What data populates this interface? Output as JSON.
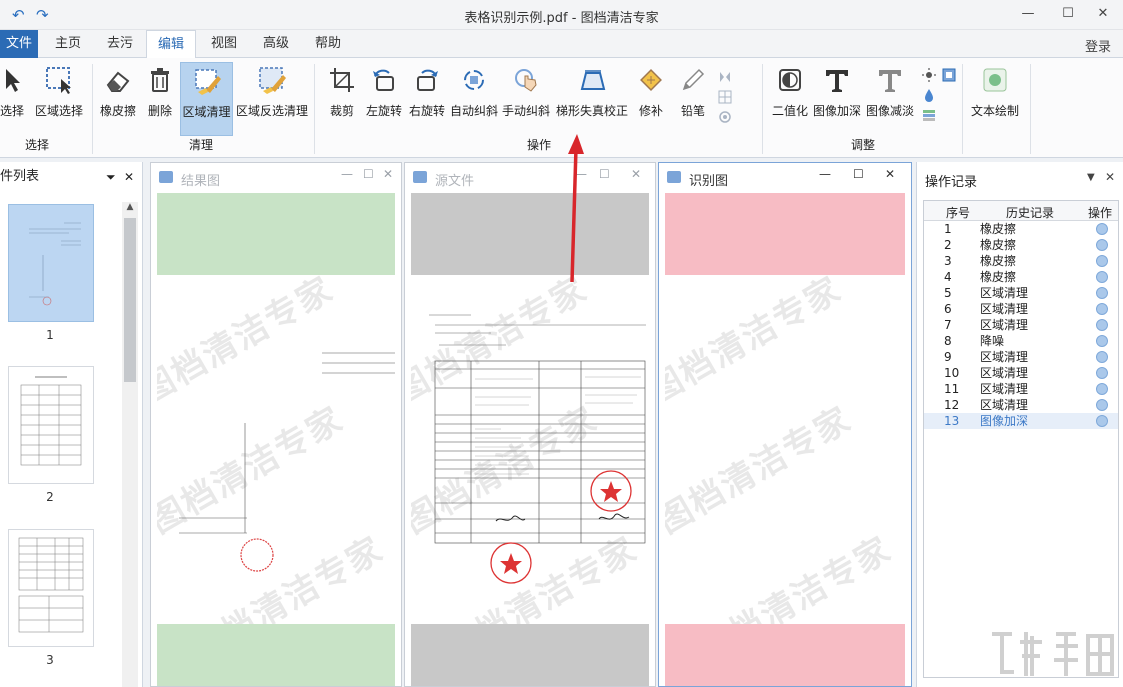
{
  "window": {
    "title": "表格识别示例.pdf - 图档清洁专家",
    "undo_icon": "undo-arrow-icon",
    "redo_icon": "redo-arrow-icon",
    "minimize_glyph": "—",
    "maximize_glyph": "☐",
    "close_glyph": "✕"
  },
  "menu": {
    "file": "文件",
    "items": [
      "主页",
      "去污",
      "编辑",
      "视图",
      "高级",
      "帮助"
    ],
    "active": "编辑",
    "login": "登录"
  },
  "ribbon": {
    "select_group": {
      "label": "选择",
      "tools": [
        "选择",
        "区域选择"
      ]
    },
    "clean_group": {
      "label": "清理",
      "tools": [
        "橡皮擦",
        "删除",
        "区域清理",
        "区域反选清理"
      ],
      "selected": "区域清理"
    },
    "operate_group": {
      "label": "操作",
      "tools": [
        "裁剪",
        "左旋转",
        "右旋转",
        "自动纠斜",
        "手动纠斜",
        "梯形失真校正",
        "修补",
        "铅笔"
      ]
    },
    "adjust_group": {
      "label": "调整",
      "tools": [
        "二值化",
        "图像加深",
        "图像减淡"
      ]
    },
    "text_group": {
      "tools": [
        "文本绘制"
      ]
    }
  },
  "left_panel": {
    "title": "件列表",
    "pages": [
      "1",
      "2",
      "3"
    ]
  },
  "panes": [
    {
      "title": "结果图",
      "band_color": "#c8e3c6"
    },
    {
      "title": "源文件",
      "band_color": "#c8c8c8"
    },
    {
      "title": "识别图",
      "band_color": "#f7bcc4"
    }
  ],
  "watermark_text": "图档清洁专家",
  "history": {
    "title": "操作记录",
    "headers": [
      "序号",
      "历史记录",
      "操作"
    ],
    "rows": [
      {
        "n": "1",
        "action": "橡皮擦"
      },
      {
        "n": "2",
        "action": "橡皮擦"
      },
      {
        "n": "3",
        "action": "橡皮擦"
      },
      {
        "n": "4",
        "action": "橡皮擦"
      },
      {
        "n": "5",
        "action": "区域清理"
      },
      {
        "n": "6",
        "action": "区域清理"
      },
      {
        "n": "7",
        "action": "区域清理"
      },
      {
        "n": "8",
        "action": "降噪"
      },
      {
        "n": "9",
        "action": "区域清理"
      },
      {
        "n": "10",
        "action": "区域清理"
      },
      {
        "n": "11",
        "action": "区域清理"
      },
      {
        "n": "12",
        "action": "区域清理"
      },
      {
        "n": "13",
        "action": "图像加深"
      }
    ],
    "highlighted": "13"
  },
  "colors": {
    "accent": "#2b6bb5",
    "selected_tool": "#b7d3ef",
    "arrow": "#d8262b"
  }
}
